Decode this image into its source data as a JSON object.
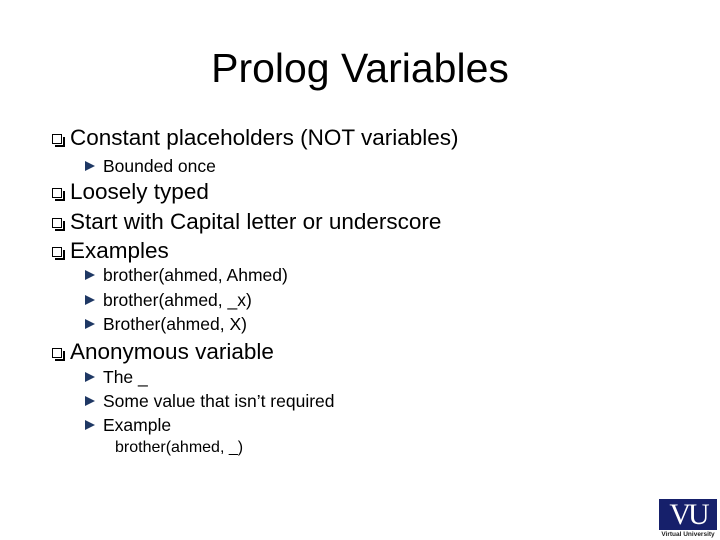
{
  "slide": {
    "title": "Prolog Variables",
    "bullets": [
      {
        "text": "Constant placeholders (NOT variables)",
        "sub": [
          "Bounded once"
        ]
      },
      {
        "text": "Loosely typed",
        "sub": []
      },
      {
        "text": "Start with Capital letter or underscore",
        "sub": []
      },
      {
        "text": "Examples",
        "sub": [
          "brother(ahmed, Ahmed)",
          "brother(ahmed, _x)",
          "Brother(ahmed, X)"
        ]
      },
      {
        "text": "Anonymous variable",
        "sub": [
          "The _",
          "Some value that isn’t required",
          "Example"
        ],
        "example_code": "brother(ahmed, _)"
      }
    ],
    "bullet_icons": {
      "level1": "checkbox-square-icon",
      "level2": "arrow-right-icon"
    },
    "colors": {
      "arrow_bullet": "#1f3864",
      "logo_bg": "#16206b"
    }
  },
  "logo": {
    "mark": "VU",
    "caption": "Virtual University"
  }
}
